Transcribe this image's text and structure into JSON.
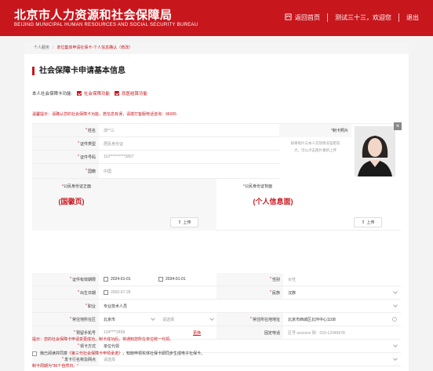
{
  "header": {
    "brand_cn": "北京市人力资源和社会保障局",
    "brand_en": "BEIJING MUNICIPAL HUMAN RESOURCES AND SOCIAL SECURITY BUREAU",
    "home": "返回首页",
    "welcome": "测试三十三，欢迎您",
    "logout": "退出"
  },
  "crumb": {
    "root": "个人服务",
    "current": "单位集体申请社保卡-个人信息确认（修改）"
  },
  "title": "社会保障卡申请基本信息",
  "features": {
    "label": "本人社会保障卡功能:",
    "f1": "社会保障功能",
    "f2": "就医结算功能"
  },
  "notice": {
    "text": "温馨提示：请确认您的社会保障卡功能，若信息有误，请拨打客服电话咨询：",
    "phone": "96065"
  },
  "form": {
    "name": {
      "label": "姓名",
      "value": "测**三"
    },
    "id_type": {
      "label": "证件类型",
      "value": "居民身份证"
    },
    "id_no": {
      "label": "证件号码",
      "value": "110**********3807"
    },
    "nationality": {
      "label": "国籍",
      "value": "中国"
    },
    "photo": {
      "label": "制卡照片",
      "hint1": "如果照片与本人实际情况差距较",
      "hint2": "大，可以点击图片重新上传",
      "close": "×"
    },
    "front": {
      "label": "公民身份证正面",
      "face": "(国徽页)",
      "upload": "上传"
    },
    "back": {
      "label": "公民身份证背面",
      "face": "(个人信息面)",
      "upload": "上传"
    },
    "validity": {
      "label": "证件有效期限",
      "start": "2024-01-01",
      "end": "2034-01-01"
    },
    "gender": {
      "label": "性别",
      "value": "女性"
    },
    "birth": {
      "label": "出生日期",
      "value": "2000-07-28"
    },
    "ethnicity": {
      "label": "民族",
      "value": "汉族"
    },
    "job": {
      "label": "职业",
      "value": "专业技术人员"
    },
    "region": {
      "label": "常住地所在区",
      "city": "北京市",
      "district": "请选择"
    },
    "address": {
      "label": "常住所在地地址",
      "value": "北京市西城区北环中心1108"
    },
    "mobile": {
      "label": "预留手机号",
      "value": "134****2458",
      "change": "更换"
    },
    "phone": {
      "label": "固定电话",
      "value": "区号-xxxxxxx 例：010-12345678"
    },
    "pickup": {
      "label": "领卡方式",
      "value": "单位代领"
    },
    "bank": {
      "label": "发卡行名称及网点",
      "value": "请选择"
    }
  },
  "bottom_tip": "提示：您的社会保障卡申请变更成功，制卡成功后，将通知您所在单位统一代领。",
  "agree": {
    "pre": "我已阅读并同意",
    "link": "《第三代社会保障卡申领承诺》",
    "post": "，知晓申领实体社保卡即同步生成电子社保卡。"
  },
  "days": "制卡周期为\"30个自然日。\""
}
